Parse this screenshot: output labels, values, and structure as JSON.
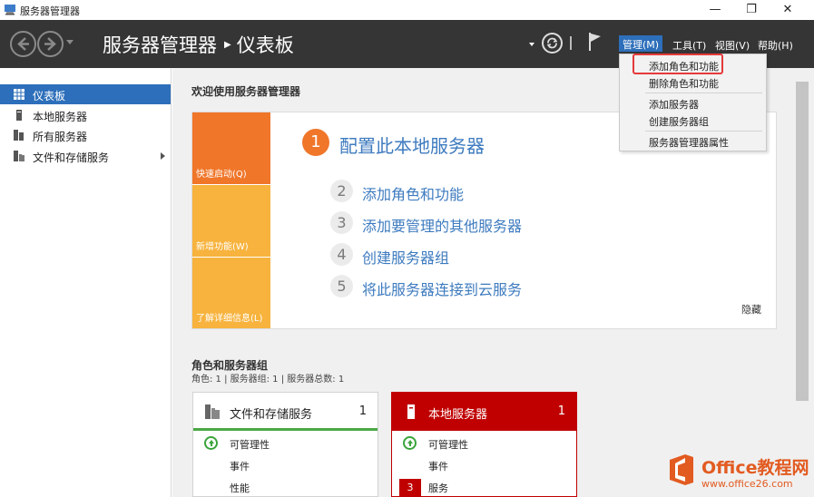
{
  "window": {
    "title": "服务器管理器",
    "controls": {
      "minimize": "—",
      "restore": "❐",
      "close": "✕"
    }
  },
  "header": {
    "breadcrumb_root": "服务器管理器",
    "breadcrumb_separator": "▶",
    "breadcrumb_current": "仪表板",
    "menus": {
      "manage": "管理(M)",
      "tools": "工具(T)",
      "view": "视图(V)",
      "help": "帮助(H)"
    }
  },
  "dropdown": {
    "items": [
      "添加角色和功能",
      "删除角色和功能",
      "添加服务器",
      "创建服务器组",
      "服务器管理器属性"
    ]
  },
  "sidebar": {
    "items": [
      {
        "label": "仪表板",
        "icon": "dashboard-icon",
        "active": true
      },
      {
        "label": "本地服务器",
        "icon": "server-icon"
      },
      {
        "label": "所有服务器",
        "icon": "servers-icon"
      },
      {
        "label": "文件和存储服务",
        "icon": "file-storage-icon"
      }
    ]
  },
  "welcome": {
    "title": "欢迎使用服务器管理器",
    "tiles": [
      "快速启动(Q)",
      "新增功能(W)",
      "了解详细信息(L)"
    ],
    "steps": [
      {
        "num": "1",
        "label": "配置此本地服务器"
      },
      {
        "num": "2",
        "label": "添加角色和功能"
      },
      {
        "num": "3",
        "label": "添加要管理的其他服务器"
      },
      {
        "num": "4",
        "label": "创建服务器组"
      },
      {
        "num": "5",
        "label": "将此服务器连接到云服务"
      }
    ],
    "hide": "隐藏"
  },
  "roles": {
    "title": "角色和服务器组",
    "subtitle": "角色: 1 | 服务器组: 1 | 服务器总数: 1",
    "cards": [
      {
        "title": "文件和存储服务",
        "count": "1",
        "rows": [
          "可管理性",
          "事件",
          "性能"
        ]
      },
      {
        "title": "本地服务器",
        "count": "1",
        "rows": [
          "可管理性",
          "事件",
          "服务"
        ],
        "badge": "3"
      }
    ]
  },
  "watermark": {
    "name": "Office教程网",
    "url": "www.office26.com"
  },
  "colors": {
    "header_bg": "#353535",
    "accent_blue": "#2d6fba",
    "quick_orange": "#f0762a",
    "tile_yellow": "#f7b33d",
    "alert_red": "#c00000",
    "ok_green": "#3aa43a",
    "link_blue": "#3e7bbf",
    "highlight_red": "#e53a3a"
  }
}
